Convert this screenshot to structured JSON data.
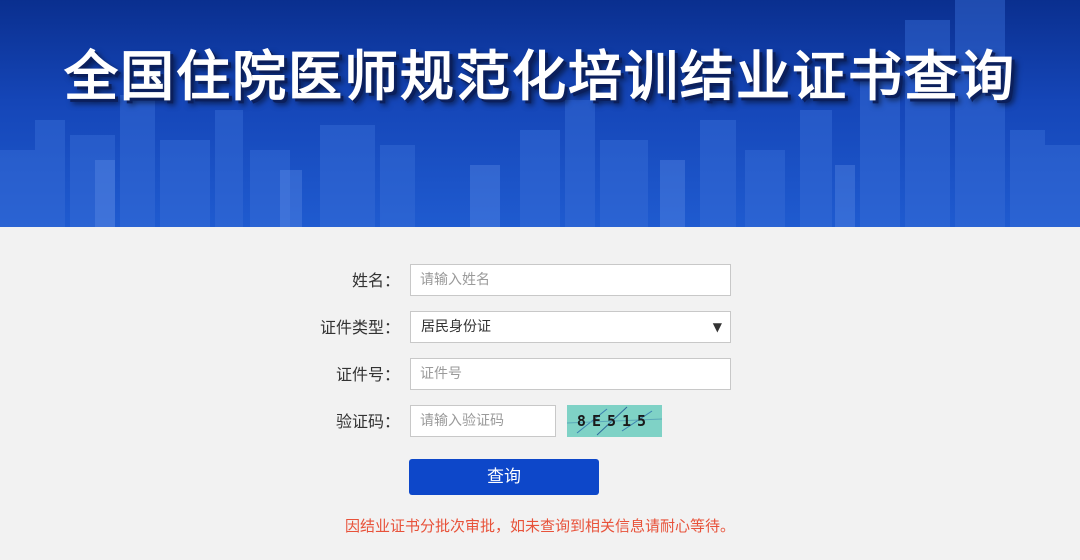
{
  "banner": {
    "title": "全国住院医师规范化培训结业证书查询"
  },
  "form": {
    "name": {
      "label": "姓名：",
      "placeholder": "请输入姓名"
    },
    "id_type": {
      "label": "证件类型：",
      "selected": "居民身份证"
    },
    "id_number": {
      "label": "证件号：",
      "placeholder": "证件号"
    },
    "captcha": {
      "label": "验证码：",
      "placeholder": "请输入验证码",
      "code": "8E515"
    },
    "submit_label": "查询",
    "notice": "因结业证书分批次审批，如未查询到相关信息请耐心等待。"
  },
  "colors": {
    "banner_dark": "#0a2f8f",
    "banner_light": "#1f5bd0",
    "button": "#0d47c9",
    "notice": "#e8523a",
    "captcha_bg": "#7fd2c6",
    "page_bg": "#f2f2f2"
  }
}
